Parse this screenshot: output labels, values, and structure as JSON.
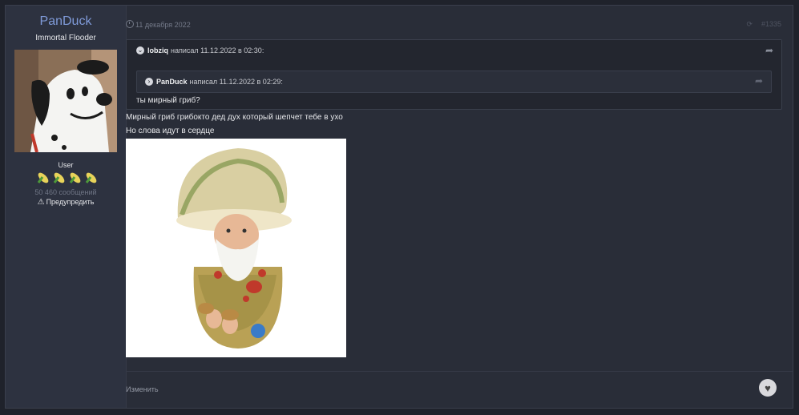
{
  "author": {
    "name": "PanDuck",
    "title": "Immortal Flooder",
    "group": "User",
    "posts_count": "50 460 сообщений",
    "warn_label": "Предупредить",
    "rank_icons": [
      "corn-icon",
      "corn-icon",
      "corn-icon",
      "corn-icon"
    ]
  },
  "post": {
    "date": "11 декабря 2022",
    "number": "#1335",
    "quote": {
      "author": "lobziq",
      "header_suffix": "написал 11.12.2022 в 02:30:",
      "inner": {
        "author": "PanDuck",
        "header_suffix": "написал 11.12.2022 в 02:29:"
      },
      "text": "ты мирный гриб?"
    },
    "lines": [
      "Мирный гриб грибокто дед дух который шепчет тебе в ухо",
      "Но слова идут в сердце"
    ],
    "edit_label": "Изменить"
  },
  "colors": {
    "background": "#1f222b",
    "panel": "#292d38",
    "author_name": "#7f9ad8"
  }
}
